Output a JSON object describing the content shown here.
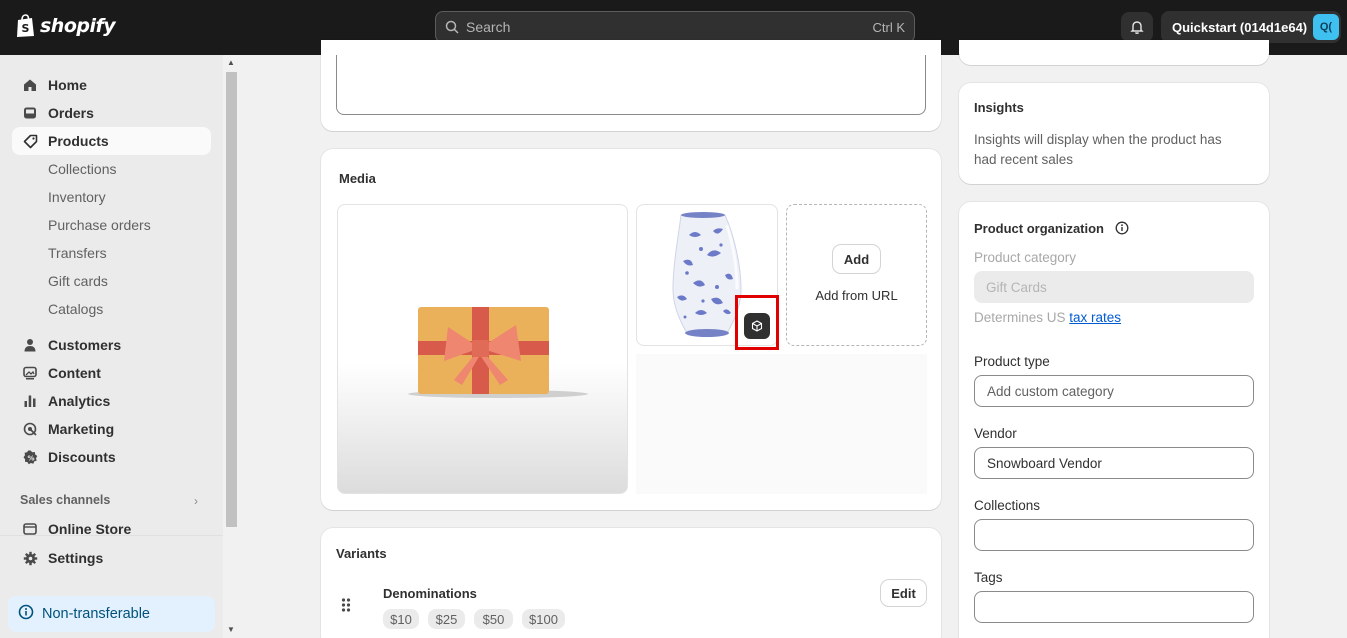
{
  "topbar": {
    "logo_text": "shopify",
    "search_placeholder": "Search",
    "search_shortcut": "Ctrl K",
    "store_name": "Quickstart (014d1e64)",
    "store_initials": "Q("
  },
  "sidebar": {
    "items": [
      {
        "label": "Home",
        "icon": "home-icon"
      },
      {
        "label": "Orders",
        "icon": "inbox-icon"
      },
      {
        "label": "Products",
        "icon": "tag-icon"
      },
      {
        "label": "Customers",
        "icon": "person-icon"
      },
      {
        "label": "Content",
        "icon": "image-icon"
      },
      {
        "label": "Analytics",
        "icon": "bar-chart-icon"
      },
      {
        "label": "Marketing",
        "icon": "target-icon"
      },
      {
        "label": "Discounts",
        "icon": "discount-icon"
      }
    ],
    "product_sub": [
      "Collections",
      "Inventory",
      "Purchase orders",
      "Transfers",
      "Gift cards",
      "Catalogs"
    ],
    "sales_channels_label": "Sales channels",
    "online_store": "Online Store",
    "settings": "Settings",
    "non_transferable": "Non-transferable"
  },
  "media": {
    "title": "Media",
    "add_button": "Add",
    "add_from_url": "Add from URL"
  },
  "variants": {
    "title": "Variants",
    "option_name": "Denominations",
    "edit_button": "Edit",
    "values": [
      "$10",
      "$25",
      "$50",
      "$100"
    ]
  },
  "insights": {
    "title": "Insights",
    "text_line1": "Insights will display when the product has",
    "text_line2": "had recent sales"
  },
  "organization": {
    "title": "Product organization",
    "category_label": "Product category",
    "category_value": "Gift Cards",
    "determines_prefix": "Determines US ",
    "tax_rates_link": "tax rates",
    "type_label": "Product type",
    "type_placeholder": "Add custom category",
    "vendor_label": "Vendor",
    "vendor_value": "Snowboard Vendor",
    "collections_label": "Collections",
    "collections_value": "",
    "tags_label": "Tags",
    "tags_value": ""
  }
}
